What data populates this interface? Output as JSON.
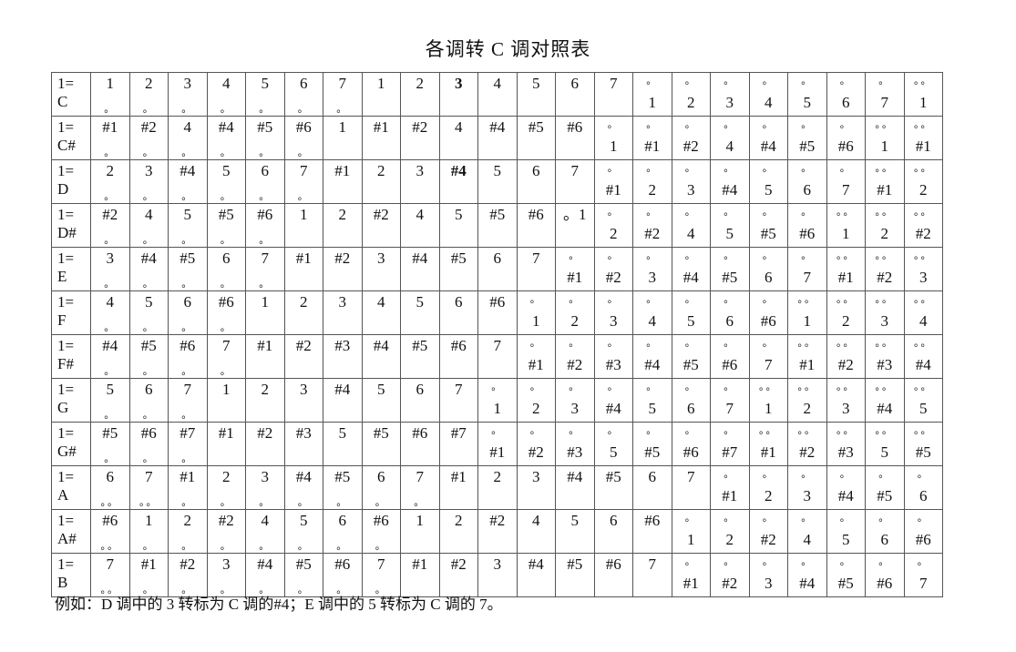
{
  "title": "各调转 C 调对照表",
  "note": "例如：D 调中的 3 转标为 C 调的#4；E 调中的 5 转标为 C 调的 7。",
  "rows": [
    {
      "key": "1=\nC",
      "cells": [
        [
          "1",
          "",
          "d"
        ],
        [
          "2",
          "",
          "d"
        ],
        [
          "3",
          "",
          "d"
        ],
        [
          "4",
          "",
          "d"
        ],
        [
          "5",
          "",
          "d"
        ],
        [
          "6",
          "",
          "d"
        ],
        [
          "7",
          "",
          "d"
        ],
        [
          "1",
          "",
          ""
        ],
        [
          "2",
          "",
          ""
        ],
        [
          "3",
          "",
          "",
          "b"
        ],
        [
          "4",
          "",
          ""
        ],
        [
          "5",
          "",
          ""
        ],
        [
          "6",
          "",
          ""
        ],
        [
          "7",
          "",
          ""
        ],
        [
          "1",
          "u",
          ""
        ],
        [
          "2",
          "u",
          ""
        ],
        [
          "3",
          "u",
          ""
        ],
        [
          "4",
          "u",
          ""
        ],
        [
          "5",
          "u",
          ""
        ],
        [
          "6",
          "u",
          ""
        ],
        [
          "7",
          "u",
          ""
        ],
        [
          "1",
          "uu",
          ""
        ]
      ]
    },
    {
      "key": "1=\nC#",
      "cells": [
        [
          "#1",
          "",
          "d"
        ],
        [
          "#2",
          "",
          "d"
        ],
        [
          "4",
          "",
          "d"
        ],
        [
          "#4",
          "",
          "d"
        ],
        [
          "#5",
          "",
          "d"
        ],
        [
          "#6",
          "",
          "d"
        ],
        [
          "1",
          "",
          ""
        ],
        [
          "#1",
          "",
          ""
        ],
        [
          "#2",
          "",
          ""
        ],
        [
          "4",
          "",
          ""
        ],
        [
          "#4",
          "",
          ""
        ],
        [
          "#5",
          "",
          ""
        ],
        [
          "#6",
          "",
          ""
        ],
        [
          "1",
          "u",
          ""
        ],
        [
          "#1",
          "u",
          ""
        ],
        [
          "#2",
          "u",
          ""
        ],
        [
          "4",
          "u",
          ""
        ],
        [
          "#4",
          "u",
          ""
        ],
        [
          "#5",
          "u",
          ""
        ],
        [
          "#6",
          "u",
          ""
        ],
        [
          "1",
          "uu",
          ""
        ],
        [
          "#1",
          "uu",
          ""
        ]
      ]
    },
    {
      "key": "1=\nD",
      "cells": [
        [
          "2",
          "",
          "d"
        ],
        [
          "3",
          "",
          "d"
        ],
        [
          "#4",
          "",
          "d"
        ],
        [
          "5",
          "",
          "d"
        ],
        [
          "6",
          "",
          "d"
        ],
        [
          "7",
          "",
          "d"
        ],
        [
          "#1",
          "",
          ""
        ],
        [
          "2",
          "",
          ""
        ],
        [
          "3",
          "",
          ""
        ],
        [
          "#4",
          "",
          "",
          "b"
        ],
        [
          "5",
          "",
          ""
        ],
        [
          "6",
          "",
          ""
        ],
        [
          "7",
          "",
          ""
        ],
        [
          "#1",
          "u",
          ""
        ],
        [
          "2",
          "u",
          ""
        ],
        [
          "3",
          "u",
          ""
        ],
        [
          "#4",
          "u",
          ""
        ],
        [
          "5",
          "u",
          ""
        ],
        [
          "6",
          "u",
          ""
        ],
        [
          "7",
          "u",
          ""
        ],
        [
          "#1",
          "uu",
          ""
        ],
        [
          "2",
          "uu",
          ""
        ]
      ]
    },
    {
      "key": "1=\nD#",
      "cells": [
        [
          "#2",
          "",
          "d"
        ],
        [
          "4",
          "",
          "d"
        ],
        [
          "5",
          "",
          "d"
        ],
        [
          "#5",
          "",
          "d"
        ],
        [
          "#6",
          "",
          "d"
        ],
        [
          "1",
          "",
          ""
        ],
        [
          "2",
          "",
          ""
        ],
        [
          "#2",
          "",
          ""
        ],
        [
          "4",
          "",
          ""
        ],
        [
          "5",
          "",
          ""
        ],
        [
          "#5",
          "",
          ""
        ],
        [
          "#6",
          "",
          ""
        ],
        [
          "。1",
          "",
          ""
        ],
        [
          "2",
          "u",
          ""
        ],
        [
          "#2",
          "u",
          ""
        ],
        [
          "4",
          "u",
          ""
        ],
        [
          "5",
          "u",
          ""
        ],
        [
          "#5",
          "u",
          ""
        ],
        [
          "#6",
          "u",
          ""
        ],
        [
          "1",
          "uu",
          ""
        ],
        [
          "2",
          "uu",
          ""
        ],
        [
          "#2",
          "uu",
          ""
        ]
      ]
    },
    {
      "key": "1=\nE",
      "cells": [
        [
          "3",
          "",
          "d"
        ],
        [
          "#4",
          "",
          "d"
        ],
        [
          "#5",
          "",
          "d"
        ],
        [
          "6",
          "",
          "d"
        ],
        [
          "7",
          "",
          "d"
        ],
        [
          "#1",
          "",
          ""
        ],
        [
          "#2",
          "",
          ""
        ],
        [
          "3",
          "",
          ""
        ],
        [
          "#4",
          "",
          ""
        ],
        [
          "#5",
          "",
          ""
        ],
        [
          "6",
          "",
          ""
        ],
        [
          "7",
          "",
          ""
        ],
        [
          "#1",
          "u",
          ""
        ],
        [
          "#2",
          "u",
          ""
        ],
        [
          "3",
          "u",
          ""
        ],
        [
          "#4",
          "u",
          ""
        ],
        [
          "#5",
          "u",
          ""
        ],
        [
          "6",
          "u",
          ""
        ],
        [
          "7",
          "u",
          ""
        ],
        [
          "#1",
          "uu",
          ""
        ],
        [
          "#2",
          "uu",
          ""
        ],
        [
          "3",
          "uu",
          ""
        ]
      ]
    },
    {
      "key": "1=\nF",
      "cells": [
        [
          "4",
          "",
          "d"
        ],
        [
          "5",
          "",
          "d"
        ],
        [
          "6",
          "",
          "d"
        ],
        [
          "#6",
          "",
          "d"
        ],
        [
          "1",
          "",
          ""
        ],
        [
          "2",
          "",
          ""
        ],
        [
          "3",
          "",
          ""
        ],
        [
          "4",
          "",
          ""
        ],
        [
          "5",
          "",
          ""
        ],
        [
          "6",
          "",
          ""
        ],
        [
          "#6",
          "",
          ""
        ],
        [
          "1",
          "u",
          ""
        ],
        [
          "2",
          "u",
          ""
        ],
        [
          "3",
          "u",
          ""
        ],
        [
          "4",
          "u",
          ""
        ],
        [
          "5",
          "u",
          ""
        ],
        [
          "6",
          "u",
          ""
        ],
        [
          "#6",
          "u",
          ""
        ],
        [
          "1",
          "uu",
          ""
        ],
        [
          "2",
          "uu",
          ""
        ],
        [
          "3",
          "uu",
          ""
        ],
        [
          "4",
          "uu",
          ""
        ]
      ]
    },
    {
      "key": "1=\nF#",
      "cells": [
        [
          "#4",
          "",
          "d"
        ],
        [
          "#5",
          "",
          "d"
        ],
        [
          "#6",
          "",
          "d"
        ],
        [
          "7",
          "",
          "d"
        ],
        [
          "#1",
          "",
          ""
        ],
        [
          "#2",
          "",
          ""
        ],
        [
          "#3",
          "",
          ""
        ],
        [
          "#4",
          "",
          ""
        ],
        [
          "#5",
          "",
          ""
        ],
        [
          "#6",
          "",
          ""
        ],
        [
          "7",
          "",
          ""
        ],
        [
          "#1",
          "u",
          ""
        ],
        [
          "#2",
          "u",
          ""
        ],
        [
          "#3",
          "u",
          ""
        ],
        [
          "#4",
          "u",
          ""
        ],
        [
          "#5",
          "u",
          ""
        ],
        [
          "#6",
          "u",
          ""
        ],
        [
          "7",
          "u",
          ""
        ],
        [
          "#1",
          "uu",
          ""
        ],
        [
          "#2",
          "uu",
          ""
        ],
        [
          "#3",
          "uu",
          ""
        ],
        [
          "#4",
          "uu",
          ""
        ]
      ]
    },
    {
      "key": "1=\nG",
      "cells": [
        [
          "5",
          "",
          "d"
        ],
        [
          "6",
          "",
          "d"
        ],
        [
          "7",
          "",
          "d"
        ],
        [
          "1",
          "",
          ""
        ],
        [
          "2",
          "",
          ""
        ],
        [
          "3",
          "",
          ""
        ],
        [
          "#4",
          "",
          ""
        ],
        [
          "5",
          "",
          ""
        ],
        [
          "6",
          "",
          ""
        ],
        [
          "7",
          "",
          ""
        ],
        [
          "1",
          "u",
          ""
        ],
        [
          "2",
          "u",
          ""
        ],
        [
          "3",
          "u",
          ""
        ],
        [
          "#4",
          "u",
          ""
        ],
        [
          "5",
          "u",
          ""
        ],
        [
          "6",
          "u",
          ""
        ],
        [
          "7",
          "u",
          ""
        ],
        [
          "1",
          "uu",
          ""
        ],
        [
          "2",
          "uu",
          ""
        ],
        [
          "3",
          "uu",
          ""
        ],
        [
          "#4",
          "uu",
          ""
        ],
        [
          "5",
          "uu",
          ""
        ]
      ]
    },
    {
      "key": "1=\nG#",
      "cells": [
        [
          "#5",
          "",
          "d"
        ],
        [
          "#6",
          "",
          "d"
        ],
        [
          "#7",
          "",
          "d"
        ],
        [
          "#1",
          "",
          ""
        ],
        [
          "#2",
          "",
          ""
        ],
        [
          "#3",
          "",
          ""
        ],
        [
          "5",
          "",
          ""
        ],
        [
          "#5",
          "",
          ""
        ],
        [
          "#6",
          "",
          ""
        ],
        [
          "#7",
          "",
          ""
        ],
        [
          "#1",
          "u",
          ""
        ],
        [
          "#2",
          "u",
          ""
        ],
        [
          "#3",
          "u",
          ""
        ],
        [
          "5",
          "u",
          ""
        ],
        [
          "#5",
          "u",
          ""
        ],
        [
          "#6",
          "u",
          ""
        ],
        [
          "#7",
          "u",
          ""
        ],
        [
          "#1",
          "uu",
          ""
        ],
        [
          "#2",
          "uu",
          ""
        ],
        [
          "#3",
          "uu",
          ""
        ],
        [
          "5",
          "uu",
          ""
        ],
        [
          "#5",
          "uu",
          ""
        ]
      ]
    },
    {
      "key": "1=\nA",
      "cells": [
        [
          "6",
          "",
          "dd"
        ],
        [
          "7",
          "",
          "dd"
        ],
        [
          "#1",
          "",
          "d"
        ],
        [
          "2",
          "",
          "d"
        ],
        [
          "3",
          "",
          "d"
        ],
        [
          "#4",
          "",
          "d"
        ],
        [
          "#5",
          "",
          "d"
        ],
        [
          "6",
          "",
          "d"
        ],
        [
          "7",
          "",
          "d"
        ],
        [
          "#1",
          "",
          ""
        ],
        [
          "2",
          "",
          ""
        ],
        [
          "3",
          "",
          ""
        ],
        [
          "#4",
          "",
          ""
        ],
        [
          "#5",
          "",
          ""
        ],
        [
          "6",
          "",
          ""
        ],
        [
          "7",
          "",
          ""
        ],
        [
          "#1",
          "u",
          ""
        ],
        [
          "2",
          "u",
          ""
        ],
        [
          "3",
          "u",
          ""
        ],
        [
          "#4",
          "u",
          ""
        ],
        [
          "#5",
          "u",
          ""
        ],
        [
          "6",
          "u",
          ""
        ]
      ]
    },
    {
      "key": "1=\nA#",
      "cells": [
        [
          "#6",
          "",
          "dd"
        ],
        [
          "1",
          "",
          "d"
        ],
        [
          "2",
          "",
          "d"
        ],
        [
          "#2",
          "",
          "d"
        ],
        [
          "4",
          "",
          "d"
        ],
        [
          "5",
          "",
          "d"
        ],
        [
          "6",
          "",
          "d"
        ],
        [
          "#6",
          "",
          "d"
        ],
        [
          "1",
          "",
          ""
        ],
        [
          "2",
          "",
          ""
        ],
        [
          "#2",
          "",
          ""
        ],
        [
          "4",
          "",
          ""
        ],
        [
          "5",
          "",
          ""
        ],
        [
          "6",
          "",
          ""
        ],
        [
          "#6",
          "",
          ""
        ],
        [
          "1",
          "u",
          ""
        ],
        [
          "2",
          "u",
          ""
        ],
        [
          "#2",
          "u",
          ""
        ],
        [
          "4",
          "u",
          ""
        ],
        [
          "5",
          "u",
          ""
        ],
        [
          "6",
          "u",
          ""
        ],
        [
          "#6",
          "u",
          ""
        ]
      ]
    },
    {
      "key": "1=\nB",
      "cells": [
        [
          "7",
          "",
          "dd"
        ],
        [
          "#1",
          "",
          "d"
        ],
        [
          "#2",
          "",
          "d"
        ],
        [
          "3",
          "",
          "d"
        ],
        [
          "#4",
          "",
          "d"
        ],
        [
          "#5",
          "",
          "d"
        ],
        [
          "#6",
          "",
          "d"
        ],
        [
          "7",
          "",
          "d"
        ],
        [
          "#1",
          "",
          ""
        ],
        [
          "#2",
          "",
          ""
        ],
        [
          "3",
          "",
          ""
        ],
        [
          "#4",
          "",
          ""
        ],
        [
          "#5",
          "",
          ""
        ],
        [
          "#6",
          "",
          ""
        ],
        [
          "7",
          "",
          ""
        ],
        [
          "#1",
          "u",
          ""
        ],
        [
          "#2",
          "u",
          ""
        ],
        [
          "3",
          "u",
          ""
        ],
        [
          "#4",
          "u",
          ""
        ],
        [
          "#5",
          "u",
          ""
        ],
        [
          "#6",
          "u",
          ""
        ],
        [
          "7",
          "u",
          ""
        ]
      ]
    }
  ]
}
